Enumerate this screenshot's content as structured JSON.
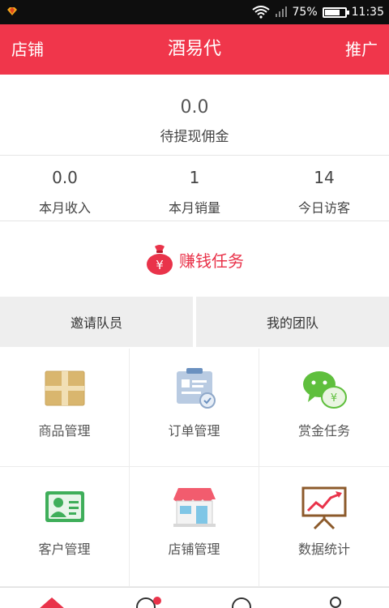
{
  "status_bar": {
    "battery_percent": "75%",
    "battery_level": 0.75,
    "time": "11:35"
  },
  "header": {
    "left_label": "店铺",
    "title": "酒易代",
    "right_label": "推广"
  },
  "commission": {
    "value": "0.0",
    "label": "待提现佣金"
  },
  "stats": [
    {
      "value": "0.0",
      "label": "本月收入"
    },
    {
      "value": "1",
      "label": "本月销量"
    },
    {
      "value": "14",
      "label": "今日访客"
    }
  ],
  "earn_task": {
    "label": "赚钱任务",
    "bag_symbol": "¥"
  },
  "team_buttons": {
    "invite": "邀请队员",
    "my_team": "我的团队"
  },
  "grid": [
    {
      "label": "商品管理",
      "icon": "package-icon"
    },
    {
      "label": "订单管理",
      "icon": "clipboard-icon"
    },
    {
      "label": "赏金任务",
      "icon": "wechat-money-icon"
    },
    {
      "label": "客户管理",
      "icon": "contact-card-icon"
    },
    {
      "label": "店铺管理",
      "icon": "storefront-icon"
    },
    {
      "label": "数据统计",
      "icon": "chart-board-icon"
    }
  ],
  "colors": {
    "brand_red": "#f0364b",
    "status_bar": "#0e0e0e"
  }
}
